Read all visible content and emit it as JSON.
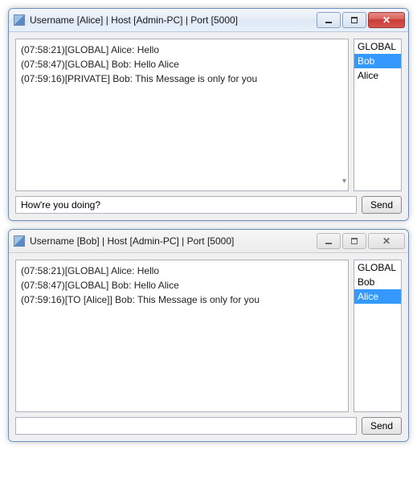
{
  "windows": [
    {
      "active": true,
      "title": "Username [Alice] | Host [Admin-PC] | Port [5000]",
      "log": [
        "(07:58:21)[GLOBAL] Alice: Hello",
        "(07:58:47)[GLOBAL] Bob: Hello Alice",
        "(07:59:16)[PRIVATE] Bob: This Message is only for you"
      ],
      "users": [
        {
          "name": "GLOBAL",
          "selected": false
        },
        {
          "name": "Bob",
          "selected": true
        },
        {
          "name": "Alice",
          "selected": false
        }
      ],
      "input_value": "How're you doing?",
      "send_label": "Send"
    },
    {
      "active": false,
      "title": "Username [Bob] | Host [Admin-PC] | Port [5000]",
      "log": [
        "(07:58:21)[GLOBAL] Alice: Hello",
        "(07:58:47)[GLOBAL] Bob: Hello Alice",
        "(07:59:16)[TO [Alice]] Bob: This Message is only for you"
      ],
      "users": [
        {
          "name": "GLOBAL",
          "selected": false
        },
        {
          "name": "Bob",
          "selected": false
        },
        {
          "name": "Alice",
          "selected": true
        }
      ],
      "input_value": "",
      "send_label": "Send"
    }
  ]
}
